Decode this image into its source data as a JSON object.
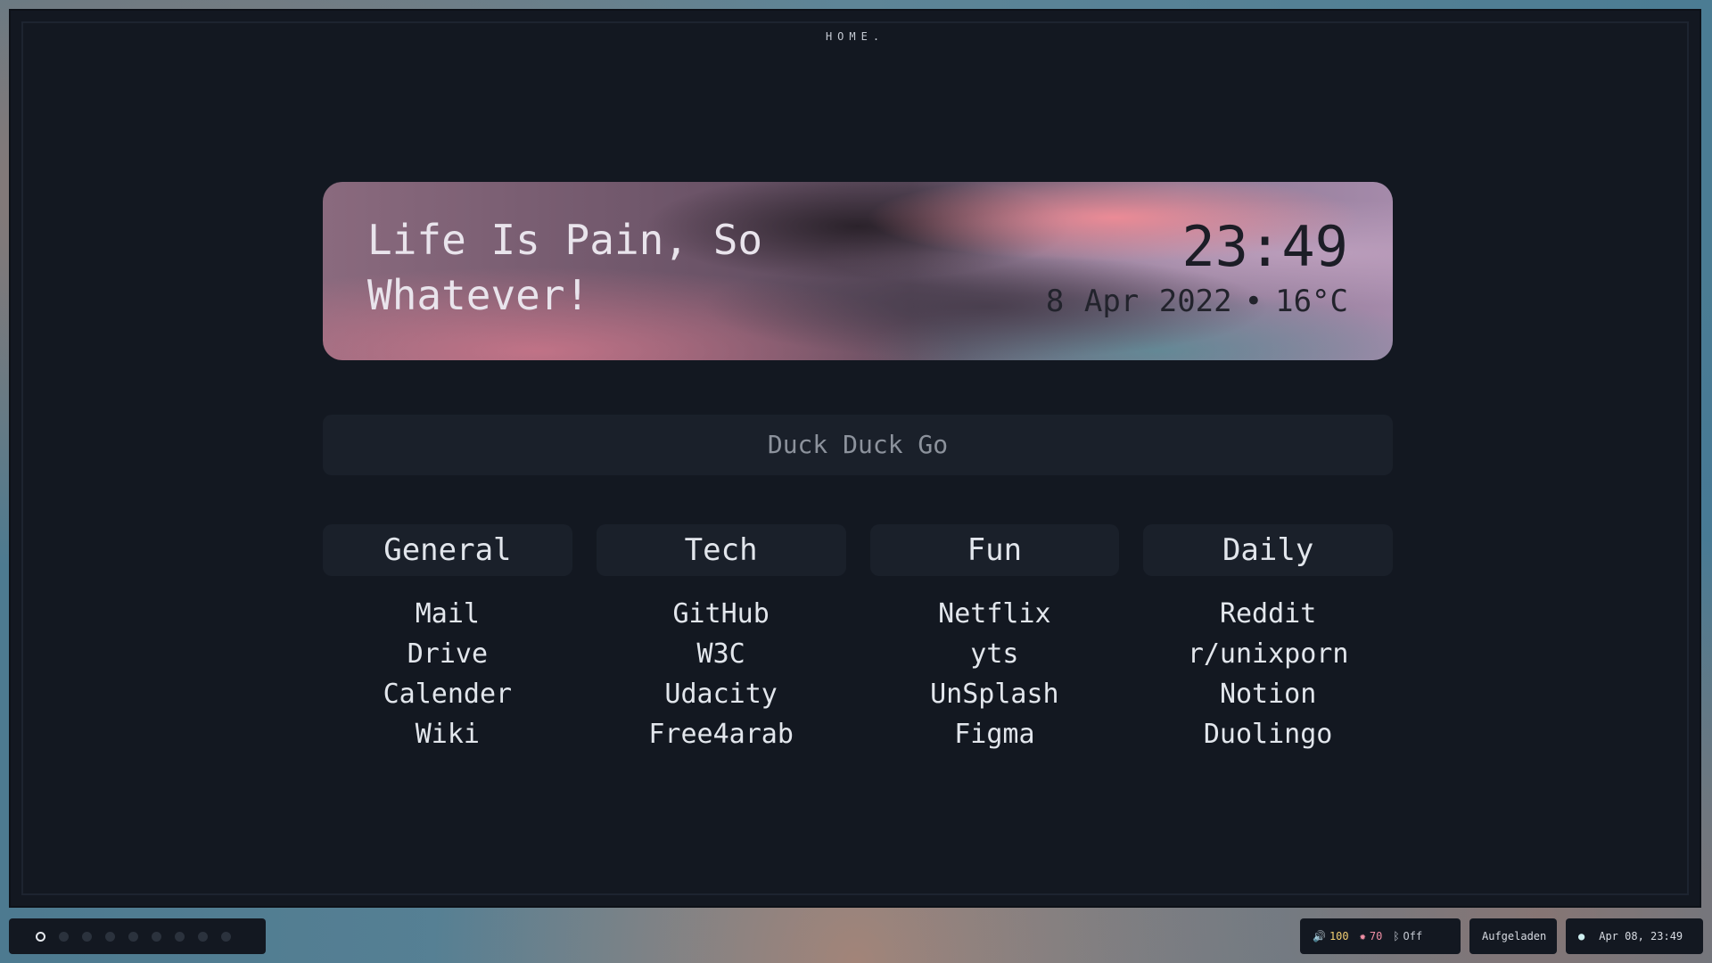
{
  "window": {
    "title": "HOME."
  },
  "hero": {
    "quote": "Life Is Pain, So Whatever!",
    "time": "23:49",
    "date": "8 Apr 2022",
    "separator": "•",
    "temperature": "16°C"
  },
  "search": {
    "placeholder": "Duck Duck Go"
  },
  "columns": [
    {
      "title": "General",
      "links": [
        "Mail",
        "Drive",
        "Calender",
        "Wiki"
      ]
    },
    {
      "title": "Tech",
      "links": [
        "GitHub",
        "W3C",
        "Udacity",
        "Free4arab"
      ]
    },
    {
      "title": "Fun",
      "links": [
        "Netflix",
        "yts",
        "UnSplash",
        "Figma"
      ]
    },
    {
      "title": "Daily",
      "links": [
        "Reddit",
        "r/unixporn",
        "Notion",
        "Duolingo"
      ]
    }
  ],
  "taskbar": {
    "workspaces": {
      "count": 9,
      "active_index": 0
    },
    "status": {
      "volume_icon": "volume-icon",
      "volume": "100",
      "brightness_icon": "brightness-icon",
      "brightness": "70",
      "bluetooth_icon": "bluetooth-icon",
      "bluetooth": "Off"
    },
    "battery": "Aufgeladen",
    "clock_icon": "clock-icon",
    "datetime": "Apr 08, 23:49"
  },
  "colors": {
    "background": "#131821",
    "card": "#1a202a",
    "text": "#e2e6ec",
    "accent_yellow": "#f2cf73",
    "accent_pink": "#f08fa5"
  }
}
